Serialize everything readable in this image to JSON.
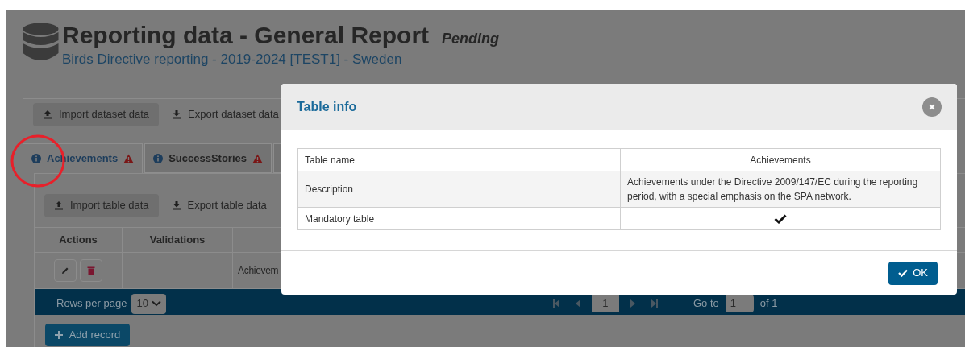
{
  "page": {
    "title": "Reporting data - General Report",
    "status": "Pending",
    "subtitle": "Birds Directive reporting - 2019-2024 [TEST1] - Sweden"
  },
  "dataset_toolbar": [
    {
      "label": "Import dataset data",
      "kind": "import"
    },
    {
      "label": "Export dataset data",
      "kind": "export"
    }
  ],
  "tabs": [
    {
      "label": "Achievements",
      "selected": true,
      "warning": true
    },
    {
      "label": "SuccessStories",
      "selected": false,
      "warning": true
    },
    {
      "selected": false,
      "warning": false
    }
  ],
  "table_toolbar": [
    {
      "label": "Import table data",
      "kind": "import"
    },
    {
      "label": "Export table data",
      "kind": "export"
    }
  ],
  "table": {
    "columns": [
      "Actions",
      "Validations"
    ],
    "rows": [
      {
        "column_3": "Achievem"
      }
    ]
  },
  "pagination": {
    "rows_per_page_label": "Rows per page",
    "rows_per_page": "10",
    "page": "1",
    "goto_label": "Go to",
    "goto_value": "1",
    "total": "of 1"
  },
  "add_record": "Add record",
  "modal": {
    "title": "Table info",
    "rows": [
      {
        "label": "Table name",
        "kind": "text",
        "value": "Achievements"
      },
      {
        "label": "Description",
        "kind": "text",
        "value": "Achievements under the Directive 2009/147/EC during the reporting period, with a special emphasis on the SPA network."
      },
      {
        "label": "Mandatory table",
        "kind": "check",
        "checked": true
      }
    ],
    "ok": "OK"
  }
}
